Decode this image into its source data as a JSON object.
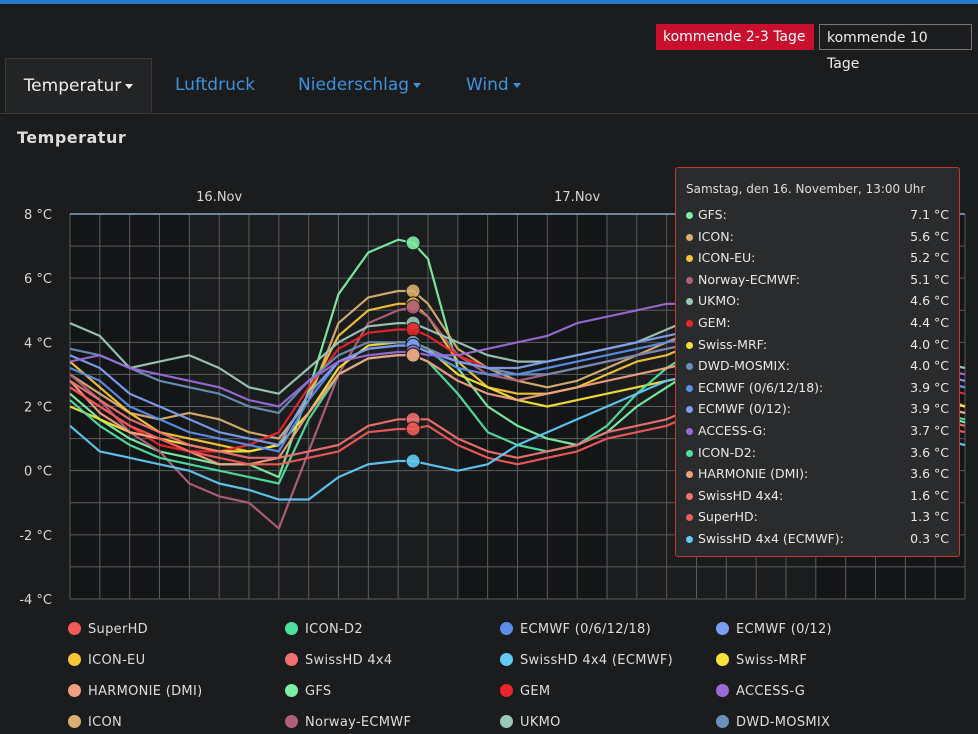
{
  "range_buttons": {
    "short": "kommende 2-3 Tage",
    "long": "kommende 10 Tage"
  },
  "tabs": [
    {
      "label": "Temperatur",
      "dropdown": true,
      "active": true
    },
    {
      "label": "Luftdruck",
      "dropdown": false,
      "active": false
    },
    {
      "label": "Niederschlag",
      "dropdown": true,
      "active": false
    },
    {
      "label": "Wind",
      "dropdown": true,
      "active": false
    }
  ],
  "section_title": "Temperatur",
  "colors": {
    "accent": "#c8102e",
    "link": "#3d92dd",
    "topbar": "#2a79c8"
  },
  "tooltip": {
    "header": "Samstag, den 16. November, 13:00 Uhr",
    "rows": [
      {
        "name": "GFS:",
        "value": "7.1 °C",
        "color": "#7df0a5"
      },
      {
        "name": "ICON:",
        "value": "5.6 °C",
        "color": "#d8b070"
      },
      {
        "name": "ICON-EU:",
        "value": "5.2 °C",
        "color": "#f6c53a"
      },
      {
        "name": "Norway-ECMWF:",
        "value": "5.1 °C",
        "color": "#b0607a"
      },
      {
        "name": "UKMO:",
        "value": "4.6 °C",
        "color": "#9cc8b8"
      },
      {
        "name": "GEM:",
        "value": "4.4 °C",
        "color": "#e8262b"
      },
      {
        "name": "Swiss-MRF:",
        "value": "4.0 °C",
        "color": "#f7e23a"
      },
      {
        "name": "DWD-MOSMIX:",
        "value": "4.0 °C",
        "color": "#6a8fb8"
      },
      {
        "name": "ECMWF (0/6/12/18):",
        "value": "3.9 °C",
        "color": "#5b8ee8"
      },
      {
        "name": "ECMWF (0/12):",
        "value": "3.9 °C",
        "color": "#7d9ef0"
      },
      {
        "name": "ACCESS-G:",
        "value": "3.7 °C",
        "color": "#9a6ad8"
      },
      {
        "name": "ICON-D2:",
        "value": "3.6 °C",
        "color": "#4fe0a0"
      },
      {
        "name": "HARMONIE (DMI):",
        "value": "3.6 °C",
        "color": "#f0a080"
      },
      {
        "name": "SwissHD 4x4:",
        "value": "1.6 °C",
        "color": "#f07070"
      },
      {
        "name": "SuperHD:",
        "value": "1.3 °C",
        "color": "#f05a5a"
      },
      {
        "name": "SwissHD 4x4 (ECMWF):",
        "value": "0.3 °C",
        "color": "#62c9f5"
      }
    ]
  },
  "legend": [
    [
      "SuperHD",
      "ICON-D2",
      "ECMWF (0/6/12/18)",
      "ECMWF (0/12)"
    ],
    [
      "ICON-EU",
      "SwissHD 4x4",
      "SwissHD 4x4 (ECMWF)",
      "Swiss-MRF"
    ],
    [
      "HARMONIE (DMI)",
      "GFS",
      "GEM",
      "ACCESS-G"
    ],
    [
      "ICON",
      "Norway-ECMWF",
      "UKMO",
      "DWD-MOSMIX"
    ]
  ],
  "chart_data": {
    "type": "line",
    "x_unit": "hours since 16.Nov 00:00",
    "xlim": [
      -10,
      50
    ],
    "ylim": [
      -4,
      8
    ],
    "yticks": [
      8,
      6,
      4,
      2,
      0,
      -2,
      -4
    ],
    "ytick_labels": [
      "8 °C",
      "6 °C",
      "4 °C",
      "2 °C",
      "0 °C",
      "-2 °C",
      "-4 °C"
    ],
    "day_labels": [
      {
        "label": "16.Nov",
        "x": 0
      },
      {
        "label": "17.Nov",
        "x": 24
      }
    ],
    "highlight_x": 13,
    "x": [
      -10,
      -8,
      -6,
      -4,
      -2,
      0,
      2,
      4,
      6,
      8,
      10,
      12,
      13,
      14,
      16,
      18,
      20,
      22,
      24,
      26,
      28,
      30,
      32,
      34,
      36,
      38,
      40,
      42,
      44,
      46,
      48,
      50
    ],
    "series": [
      {
        "name": "GFS",
        "color": "#7df0a5",
        "values": [
          2.4,
          1.6,
          1.0,
          0.6,
          0.4,
          0.2,
          0.2,
          -0.2,
          2.5,
          5.5,
          6.8,
          7.2,
          7.1,
          6.6,
          3.2,
          2.0,
          1.4,
          1.0,
          0.8,
          1.2,
          2.0,
          2.6,
          3.2,
          4.0,
          5.0,
          5.6,
          6.2,
          5.0,
          3.5,
          2.5,
          1.8,
          1.5
        ]
      },
      {
        "name": "ICON",
        "color": "#d8b070",
        "values": [
          3.0,
          2.4,
          1.8,
          1.6,
          1.8,
          1.6,
          1.2,
          1.0,
          2.2,
          4.6,
          5.4,
          5.6,
          5.6,
          5.2,
          3.8,
          3.2,
          2.8,
          2.6,
          2.8,
          3.2,
          3.6,
          4.0,
          4.4,
          4.8,
          5.4,
          6.2,
          6.6,
          5.0,
          3.8,
          3.0,
          2.4,
          2.0
        ]
      },
      {
        "name": "ICON-EU",
        "color": "#f6c53a",
        "values": [
          3.4,
          2.6,
          1.8,
          1.2,
          1.0,
          0.8,
          0.6,
          0.8,
          2.4,
          4.2,
          5.0,
          5.2,
          5.2,
          4.8,
          3.4,
          2.6,
          2.4,
          2.4,
          2.6,
          3.0,
          3.4,
          3.6,
          4.0,
          4.4,
          5.0,
          5.6,
          5.8,
          4.4,
          3.2,
          2.6,
          2.0,
          1.8
        ]
      },
      {
        "name": "Norway-ECMWF",
        "color": "#b0607a",
        "values": [
          3.0,
          2.2,
          1.2,
          0.6,
          -0.4,
          -0.8,
          -1.0,
          -1.8,
          0.6,
          3.0,
          4.6,
          5.0,
          5.1,
          4.8,
          3.6,
          3.0,
          2.8,
          3.0,
          3.2,
          3.4,
          3.6,
          3.8,
          4.0,
          4.2,
          4.4,
          4.8,
          5.0,
          4.2,
          3.4,
          3.0,
          2.8,
          2.6
        ]
      },
      {
        "name": "UKMO",
        "color": "#9cc8b8",
        "values": [
          4.6,
          4.2,
          3.2,
          3.4,
          3.6,
          3.2,
          2.6,
          2.4,
          3.2,
          4.0,
          4.5,
          4.6,
          4.6,
          4.4,
          4.0,
          3.6,
          3.4,
          3.4,
          3.6,
          3.8,
          4.0,
          4.4,
          4.8,
          5.0,
          5.4,
          5.6,
          5.2,
          4.6,
          4.0,
          3.6,
          3.4,
          3.2
        ]
      },
      {
        "name": "GEM",
        "color": "#e8262b",
        "values": [
          2.6,
          2.0,
          1.4,
          0.8,
          0.6,
          0.6,
          0.8,
          1.2,
          2.6,
          3.8,
          4.3,
          4.4,
          4.4,
          4.2,
          3.6,
          3.2,
          3.0,
          3.0,
          3.2,
          3.4,
          3.6,
          3.8,
          4.0,
          4.2,
          4.4,
          4.6,
          4.6,
          4.0,
          3.2,
          2.8,
          2.6,
          2.4
        ]
      },
      {
        "name": "Swiss-MRF",
        "color": "#f7e23a",
        "values": [
          2.0,
          1.6,
          1.2,
          1.0,
          0.8,
          0.6,
          0.6,
          0.8,
          1.8,
          3.2,
          3.9,
          4.0,
          4.0,
          3.8,
          3.0,
          2.6,
          2.2,
          2.0,
          2.2,
          2.4,
          2.6,
          2.8,
          3.0,
          3.2,
          3.6,
          3.8,
          3.6,
          3.0,
          2.6,
          2.4,
          2.2,
          2.0
        ]
      },
      {
        "name": "DWD-MOSMIX",
        "color": "#6a8fb8",
        "values": [
          3.8,
          3.6,
          3.2,
          2.8,
          2.6,
          2.4,
          2.0,
          1.8,
          2.8,
          3.6,
          4.0,
          4.0,
          4.0,
          3.8,
          3.4,
          3.2,
          3.0,
          3.0,
          3.2,
          3.4,
          3.6,
          3.8,
          4.0,
          4.2,
          4.4,
          4.6,
          4.4,
          3.8,
          3.2,
          3.0,
          2.8,
          2.6
        ]
      },
      {
        "name": "ECMWF (0/6/12/18)",
        "color": "#5b8ee8",
        "values": [
          3.2,
          2.8,
          2.0,
          1.6,
          1.2,
          1.0,
          0.8,
          0.6,
          2.2,
          3.4,
          3.8,
          3.9,
          3.9,
          3.7,
          3.2,
          3.0,
          3.0,
          3.2,
          3.4,
          3.6,
          3.8,
          4.0,
          4.2,
          4.4,
          4.6,
          4.8,
          4.6,
          4.0,
          3.4,
          3.0,
          2.8,
          2.6
        ]
      },
      {
        "name": "ECMWF (0/12)",
        "color": "#7d9ef0",
        "values": [
          3.6,
          3.2,
          2.4,
          2.0,
          1.6,
          1.2,
          1.0,
          0.8,
          2.4,
          3.4,
          3.8,
          3.9,
          3.9,
          3.7,
          3.4,
          3.2,
          3.2,
          3.4,
          3.6,
          3.8,
          4.0,
          4.2,
          4.4,
          4.6,
          4.8,
          5.0,
          4.8,
          4.2,
          3.6,
          3.2,
          3.0,
          2.8
        ]
      },
      {
        "name": "ACCESS-G",
        "color": "#9a6ad8",
        "values": [
          3.4,
          3.6,
          3.2,
          3.0,
          2.8,
          2.6,
          2.2,
          2.0,
          2.8,
          3.4,
          3.6,
          3.7,
          3.7,
          3.6,
          3.6,
          3.8,
          4.0,
          4.2,
          4.6,
          4.8,
          5.0,
          5.2,
          5.2,
          5.0,
          4.8,
          4.6,
          4.4,
          4.0,
          3.6,
          3.4,
          3.2,
          3.0
        ]
      },
      {
        "name": "ICON-D2",
        "color": "#4fe0a0",
        "values": [
          2.2,
          1.4,
          0.8,
          0.4,
          0.2,
          0.0,
          -0.2,
          -0.4,
          1.6,
          3.0,
          3.5,
          3.6,
          3.6,
          3.4,
          2.4,
          1.2,
          0.8,
          0.6,
          0.8,
          1.4,
          2.4,
          3.2,
          3.8,
          4.4,
          5.0,
          5.4,
          5.8,
          4.6,
          3.2,
          2.4,
          1.8,
          1.6
        ]
      },
      {
        "name": "HARMONIE (DMI)",
        "color": "#f0a080",
        "values": [
          2.8,
          1.8,
          1.2,
          1.0,
          0.6,
          0.2,
          0.2,
          0.4,
          1.8,
          3.0,
          3.5,
          3.6,
          3.6,
          3.4,
          2.8,
          2.4,
          2.2,
          2.4,
          2.6,
          2.8,
          3.0,
          3.2,
          3.4,
          3.6,
          3.8,
          4.0,
          3.8,
          3.2,
          2.6,
          2.2,
          2.0,
          1.8
        ]
      },
      {
        "name": "SwissHD 4x4",
        "color": "#f07070",
        "values": [
          2.8,
          2.2,
          1.6,
          1.2,
          0.8,
          0.6,
          0.4,
          0.4,
          0.6,
          0.8,
          1.4,
          1.6,
          1.6,
          1.6,
          1.0,
          0.6,
          0.4,
          0.6,
          0.8,
          1.2,
          1.4,
          1.6,
          2.0,
          2.4,
          2.8,
          3.2,
          3.6,
          2.8,
          2.2,
          1.8,
          1.6,
          1.4
        ]
      },
      {
        "name": "SuperHD",
        "color": "#f05a5a",
        "values": [
          2.6,
          2.0,
          1.4,
          1.0,
          0.6,
          0.4,
          0.2,
          0.2,
          0.4,
          0.6,
          1.2,
          1.3,
          1.3,
          1.4,
          0.8,
          0.4,
          0.2,
          0.4,
          0.6,
          1.0,
          1.2,
          1.4,
          1.8,
          2.2,
          2.6,
          3.0,
          3.4,
          2.6,
          2.0,
          1.6,
          1.4,
          1.2
        ]
      },
      {
        "name": "SwissHD 4x4 (ECMWF)",
        "color": "#62c9f5",
        "values": [
          1.4,
          0.6,
          0.4,
          0.2,
          0.0,
          -0.4,
          -0.6,
          -0.9,
          -0.9,
          -0.2,
          0.2,
          0.3,
          0.3,
          0.2,
          0.0,
          0.2,
          0.8,
          1.2,
          1.6,
          2.0,
          2.4,
          2.8,
          3.0,
          3.2,
          3.4,
          3.2,
          3.0,
          2.0,
          1.6,
          1.2,
          1.0,
          0.8
        ]
      }
    ]
  }
}
